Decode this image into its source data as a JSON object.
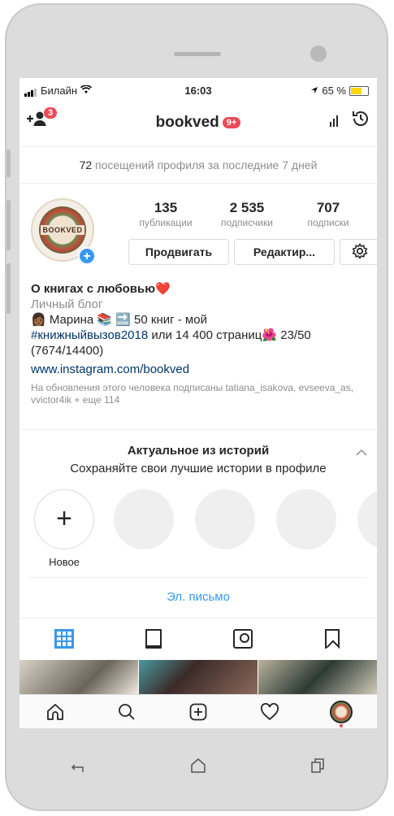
{
  "status_bar": {
    "carrier": "Билайн",
    "time": "16:03",
    "battery_percent": "65 %",
    "battery_level": 0.65
  },
  "header": {
    "username": "bookved",
    "notifications_badge": "9+",
    "add_user_badge": "3"
  },
  "visits": {
    "count": "72",
    "text": "посещений профиля за последние 7 дней"
  },
  "profile": {
    "avatar_text": "BOOKVED",
    "stats": [
      {
        "value": "135",
        "label": "публикации"
      },
      {
        "value": "2 535",
        "label": "подписчики"
      },
      {
        "value": "707",
        "label": "подписки"
      }
    ],
    "buttons": {
      "promote": "Продвигать",
      "edit": "Редактир..."
    },
    "name": "О книгах с любовью",
    "name_emoji": "❤️",
    "category": "Личный блог",
    "bio_line1": "👩🏾 Марина 📚 🔜 50 книг - мой",
    "bio_hashtag": "#книжныйвызов2018",
    "bio_line2_rest": " или 14 400 страниц🌺 23/50",
    "bio_line3": "(7674/14400)",
    "website": "www.instagram.com/bookved",
    "followed_by": "На обновления этого человека подписаны tatiana_isakova, evseeva_as, vvictor4ik + еще 114"
  },
  "highlights": {
    "title": "Актуальное из историй",
    "subtitle": "Сохраняйте свои лучшие истории в профиле",
    "new_label": "Новое"
  },
  "email_button": "Эл. письмо",
  "icons": [
    "add-user-icon",
    "insights-icon",
    "archive-history-icon",
    "settings-gear-icon",
    "grid-icon",
    "feed-icon",
    "tagged-icon",
    "saved-icon",
    "home-icon",
    "search-icon",
    "add-post-icon",
    "heart-icon",
    "profile-avatar-icon",
    "back-icon",
    "home-hardware-icon",
    "recents-icon"
  ],
  "colors": {
    "accent": "#3897f0",
    "badge": "#ed4956",
    "link": "#003569"
  }
}
